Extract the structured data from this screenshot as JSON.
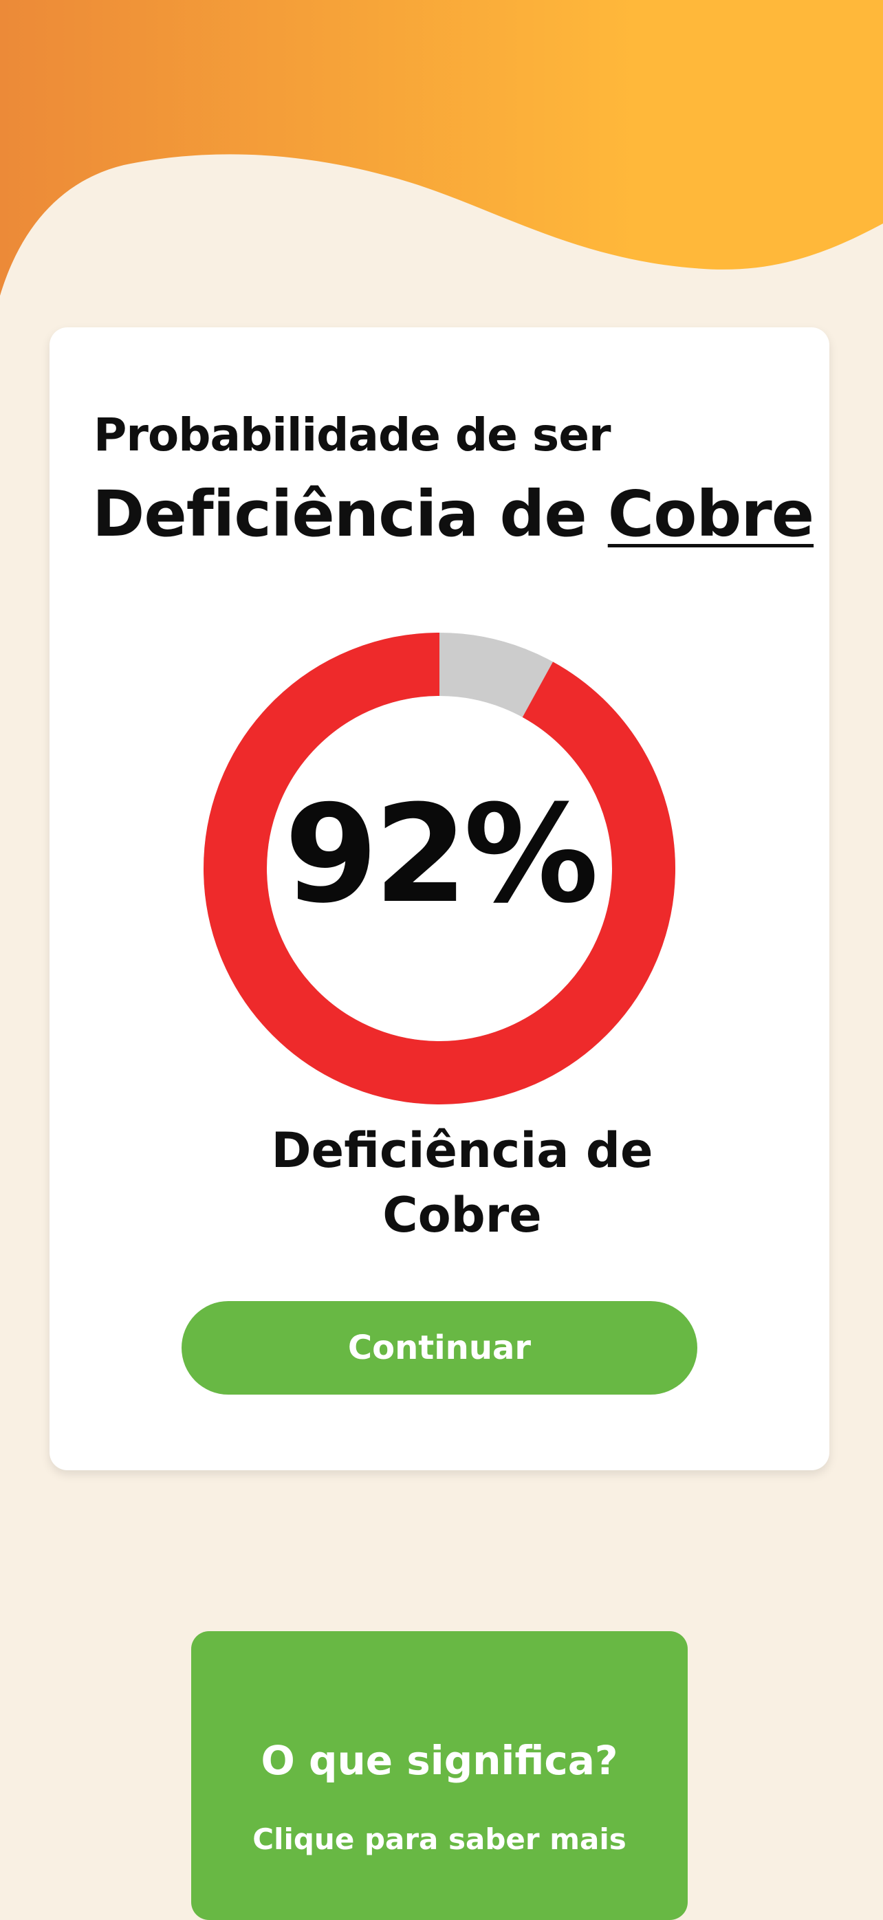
{
  "colors": {
    "background": "#f9f0e3",
    "header_gradient_start": "#ec8a38",
    "header_gradient_end": "#ffb83a",
    "card": "#ffffff",
    "donut_filled": "#ee2a2b",
    "donut_empty": "#cccccc",
    "accent_green": "#68b844"
  },
  "card": {
    "subtitle": "Probabilidade de ser",
    "title_prefix": "Deficiência de ",
    "title_highlight": "Cobre"
  },
  "result": {
    "value_text": "92%",
    "fraction": 0.92,
    "label_line1": "Deficiência de",
    "label_line2": "Cobre"
  },
  "actions": {
    "continue_label": "Continuar"
  },
  "info": {
    "title": "O que significa?",
    "subtitle": "Clique para saber mais"
  }
}
